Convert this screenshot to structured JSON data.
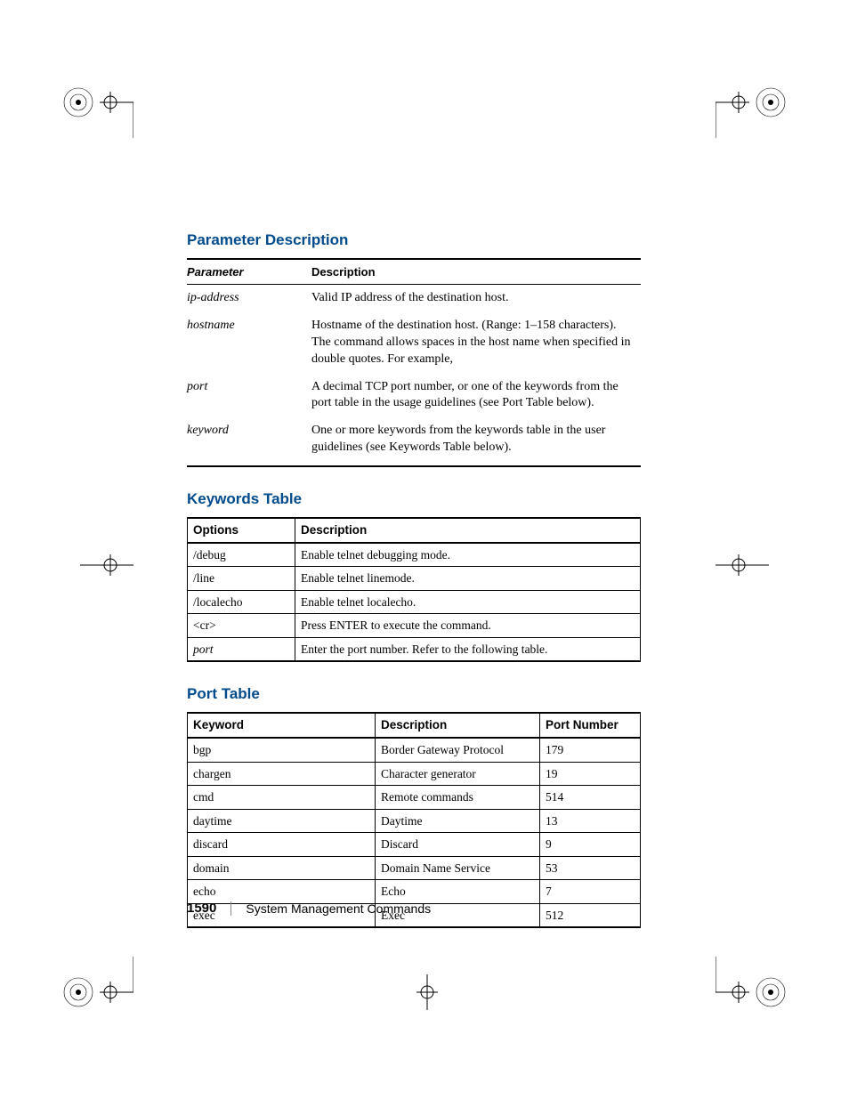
{
  "sections": {
    "param_desc_title": "Parameter Description",
    "keywords_title": "Keywords Table",
    "port_title": "Port Table"
  },
  "param_table": {
    "headers": {
      "parameter": "Parameter",
      "description": "Description"
    },
    "rows": [
      {
        "param": "ip-address",
        "desc": "Valid IP address of the destination host."
      },
      {
        "param": "hostname",
        "desc": "Hostname of the destination host. (Range: 1–158 characters). The command allows spaces in the host name when specified in double quotes. For example,"
      },
      {
        "param": "port",
        "desc": "A decimal TCP port number, or one of the keywords from the port table in the usage guidelines (see Port Table below)."
      },
      {
        "param": "keyword",
        "desc": "One or more keywords from the keywords table in the user guidelines (see Keywords Table below)."
      }
    ]
  },
  "keywords_table": {
    "headers": {
      "options": "Options",
      "description": "Description"
    },
    "rows": [
      {
        "opt": "/debug",
        "italic": false,
        "desc": "Enable telnet debugging mode."
      },
      {
        "opt": "/line",
        "italic": false,
        "desc": "Enable telnet linemode."
      },
      {
        "opt": "/localecho",
        "italic": false,
        "desc": "Enable telnet localecho."
      },
      {
        "opt": "<cr>",
        "italic": false,
        "desc": "Press ENTER to execute the command."
      },
      {
        "opt": "port",
        "italic": true,
        "desc": "Enter the port number. Refer to the following table."
      }
    ]
  },
  "port_table": {
    "headers": {
      "keyword": "Keyword",
      "description": "Description",
      "port": "Port Number"
    },
    "rows": [
      {
        "kw": "bgp",
        "desc": "Border Gateway Protocol",
        "port": "179"
      },
      {
        "kw": "chargen",
        "desc": "Character generator",
        "port": "19"
      },
      {
        "kw": "cmd",
        "desc": "Remote commands",
        "port": "514"
      },
      {
        "kw": "daytime",
        "desc": "Daytime",
        "port": "13"
      },
      {
        "kw": "discard",
        "desc": "Discard",
        "port": "9"
      },
      {
        "kw": "domain",
        "desc": "Domain Name Service",
        "port": "53"
      },
      {
        "kw": "echo",
        "desc": "Echo",
        "port": "7"
      },
      {
        "kw": "exec",
        "desc": "Exec",
        "port": "512"
      }
    ]
  },
  "footer": {
    "page_number": "1590",
    "chapter": "System Management Commands"
  }
}
